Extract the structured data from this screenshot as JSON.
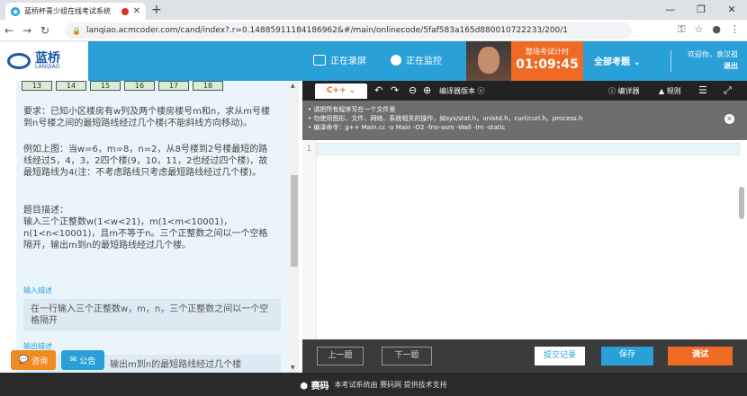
{
  "browser": {
    "tab_title": "蓝桥杯青少组在线考试系统",
    "url": "lanqiao.acmcoder.com/cand/index?.r=0.14885911184186962&#/main/onlinecode/5faf583a165d880010722233/200/1"
  },
  "header": {
    "logo_text": "蓝桥",
    "logo_sub": "LANQIAO",
    "recording": "正在录屏",
    "monitoring": "正在监控",
    "timer_label": "整场考试计时",
    "timer_value": "01:09:45",
    "all_questions": "全部考题",
    "welcome": "欢迎你，袁汉祖",
    "exit": "退出"
  },
  "problem": {
    "numbers": [
      "13",
      "14",
      "15",
      "16",
      "17",
      "18"
    ],
    "requirement": "要求：已知小区楼房有w列及两个楼房楼号m和n，求从m号楼到n号楼之间的最短路线经过几个楼(不能斜线方向移动)。",
    "example": "例如上图：当w=6，m=8，n=2，从8号楼到2号楼最短的路线经过5，4，3，2四个楼(9，10，11，2也经过四个楼)，故最短路线为4(注：不考虑路线只考虑最短路线经过几个楼)。",
    "desc_title": "题目描述：",
    "desc": "输入三个正整数w(1<w<21)，m(1<m<10001)，n(1<n<10001)，且m不等于n。三个正整数之间以一个空格隔开，输出m到n的最短路线经过几个楼。",
    "input_label": "输入描述",
    "input_desc": "在一行输入三个正整数w，m，n，三个正整数之间以一个空格隔开",
    "output_label": "输出描述",
    "output_desc": "输出m到n的最短路线经过几个楼"
  },
  "float_buttons": {
    "consult": "咨询",
    "notice": "公告"
  },
  "editor": {
    "language": "C++",
    "version_label": "编译器版本",
    "detail": "编详器",
    "rules": "规则",
    "notice_lines": [
      "请把所有程序写在一个文件里",
      "勿使用图形、文件、网络、系统相关的操作，如sys/stat.h，unistd.h，curl/curl.h，process.h",
      "编译命令：g++ Main.cc -o Main -O2 -fno-asm -Wall -lm -static"
    ],
    "line_number": "1"
  },
  "actions": {
    "prev": "上一题",
    "next": "下一题",
    "records": "提交记录",
    "save": "保存",
    "debug": "调试"
  },
  "footer": {
    "brand": "赛码",
    "text": "本考试系统由 赛码网 提供技术支持"
  },
  "colors": {
    "accent": "#2aa0d8",
    "orange": "#f06a24",
    "editor_dark": "#222222"
  }
}
